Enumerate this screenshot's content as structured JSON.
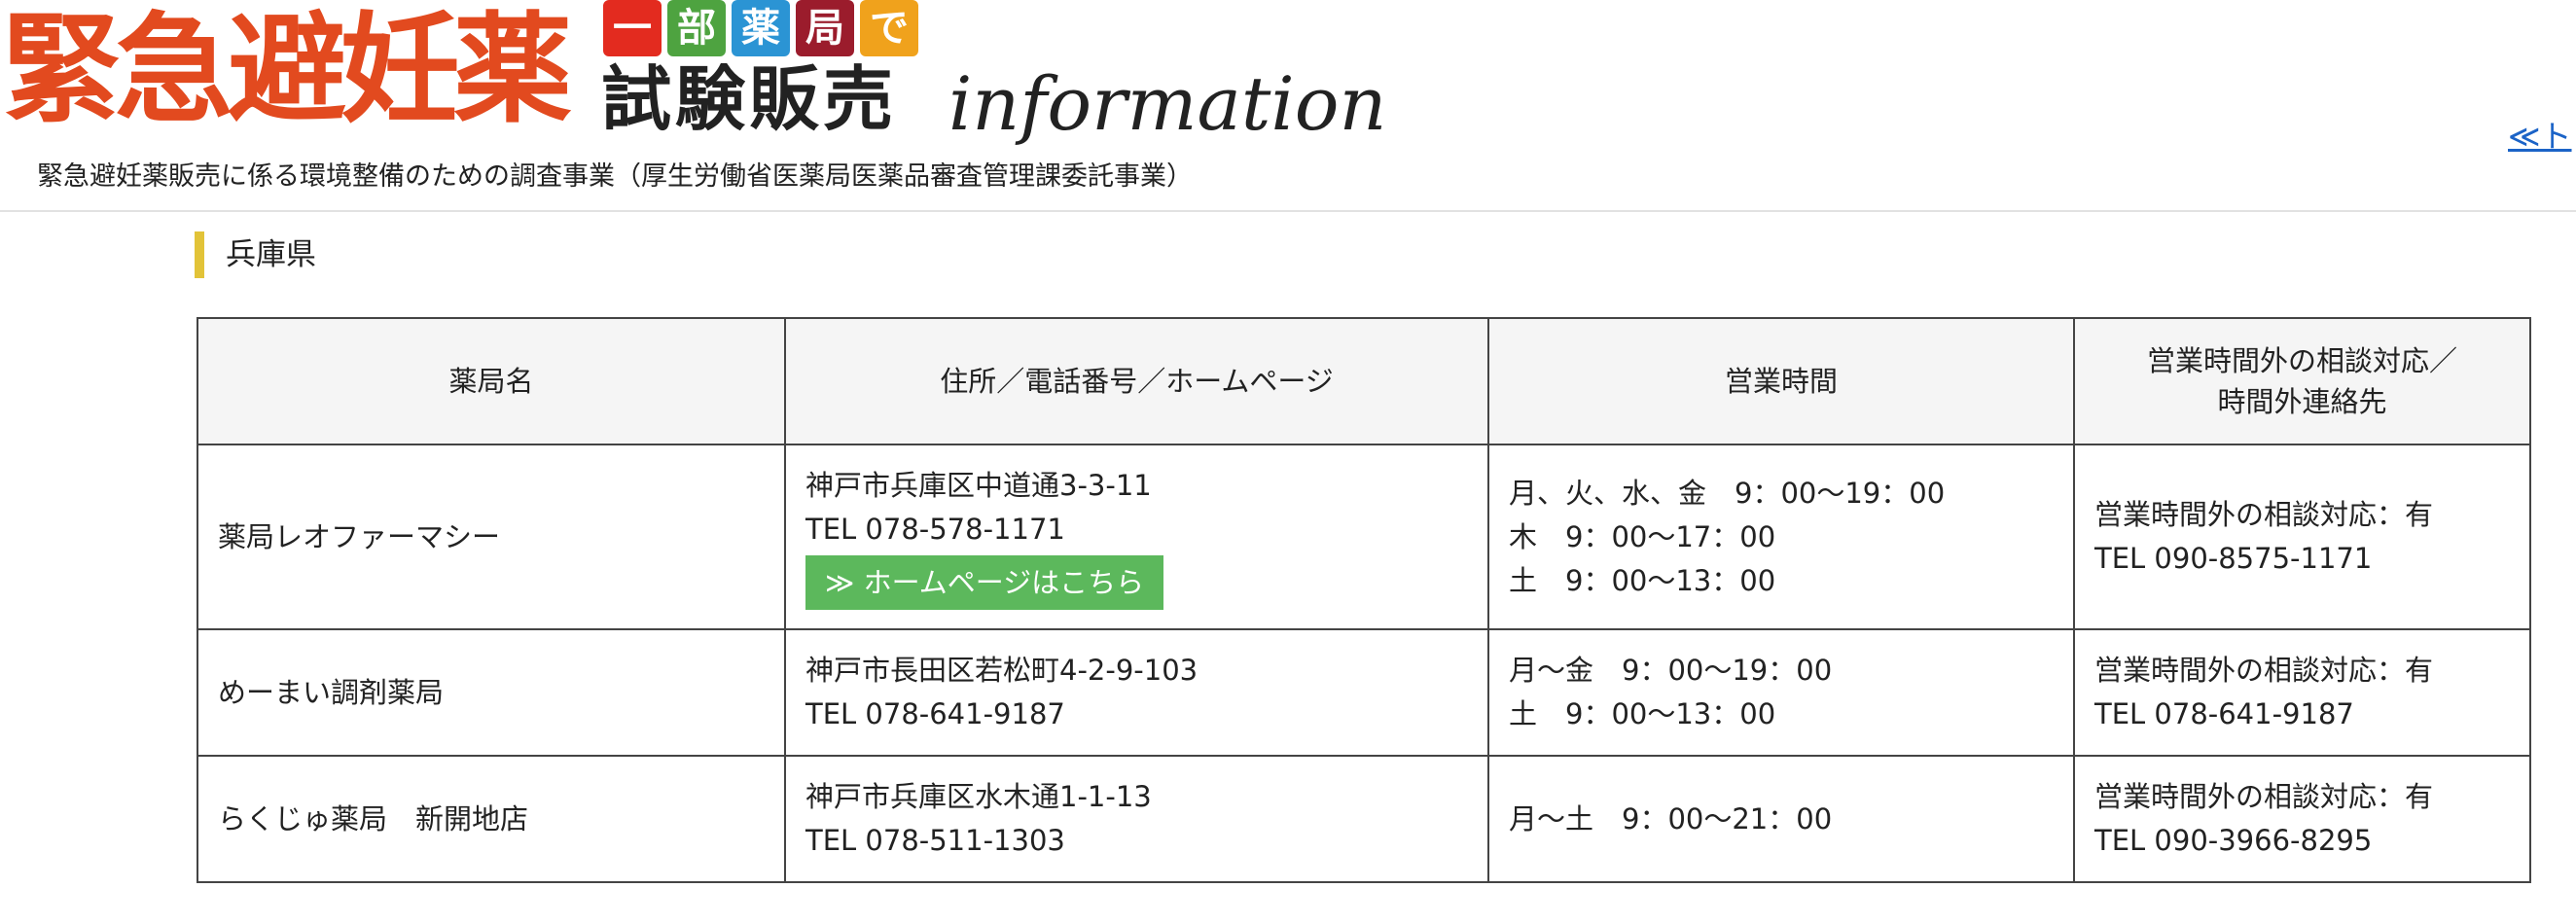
{
  "header": {
    "logo_main": "緊急避妊薬",
    "logo_chars": [
      "一",
      "部",
      "薬",
      "局",
      "で"
    ],
    "logo_trial": "試験販売",
    "logo_info": "information",
    "subtitle": "緊急避妊薬販売に係る環境整備のための調査事業（厚生労働省医薬局医薬品審査管理課委託事業）",
    "top_link": "≪ト"
  },
  "section": {
    "title": "兵庫県"
  },
  "table": {
    "headers": {
      "name": "薬局名",
      "address": "住所／電話番号／ホームページ",
      "hours": "営業時間",
      "after_hours_line1": "営業時間外の相談対応／",
      "after_hours_line2": "時間外連絡先"
    },
    "rows": [
      {
        "name": "薬局レオファーマシー",
        "address": "神戸市兵庫区中道通3-3-11",
        "tel": "TEL 078-578-1171",
        "homepage_label": "≫ ホームページはこちら",
        "hours": [
          "月、火、水、金　9：00〜19：00",
          "木　9：00〜17：00",
          "土　9：00〜13：00"
        ],
        "after_hours": "営業時間外の相談対応：有",
        "after_tel": "TEL 090-8575-1171"
      },
      {
        "name": "めーまい調剤薬局",
        "address": "神戸市長田区若松町4-2-9-103",
        "tel": "TEL 078-641-9187",
        "hours": [
          "月〜金　9：00〜19：00",
          "土　9：00〜13：00"
        ],
        "after_hours": "営業時間外の相談対応：有",
        "after_tel": "TEL 078-641-9187"
      },
      {
        "name": "らくじゅ薬局　新開地店",
        "address": "神戸市兵庫区水木通1-1-13",
        "tel": "TEL 078-511-1303",
        "hours": [
          "月〜土　9：00〜21：00"
        ],
        "after_hours": "営業時間外の相談対応：有",
        "after_tel": "TEL 090-3966-8295"
      }
    ]
  },
  "colors": {
    "logo_red": "#e24a1f",
    "section_bar": "#e2c338",
    "button_green": "#5cb85c",
    "link_blue": "#1b63c7"
  }
}
